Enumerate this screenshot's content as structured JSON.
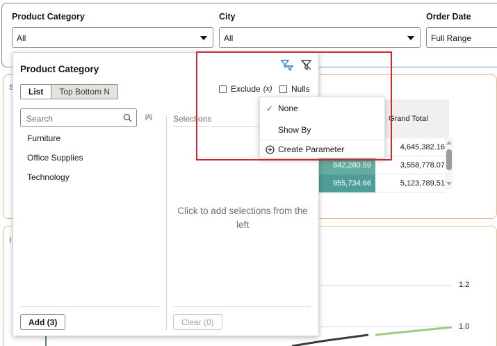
{
  "filters": [
    {
      "label": "Product Category",
      "value": "All"
    },
    {
      "label": "City",
      "value": "All"
    },
    {
      "label": "Order Date",
      "value": "Full Range"
    }
  ],
  "popup": {
    "title": "Product Category",
    "tabs": [
      {
        "label": "List"
      },
      {
        "label": "Top Bottom N"
      }
    ],
    "exclude_label": "Exclude",
    "exclude_suffix": "(x)",
    "nulls_label": "Nulls",
    "search_placeholder": "Search",
    "case_icon_text": "[A]",
    "items": [
      "Furniture",
      "Office Supplies",
      "Technology"
    ],
    "selections_label": "Selections",
    "empty_hint": "Click to add selections from the left",
    "add_button": "Add (3)",
    "clear_button": "Clear (0)"
  },
  "menu": {
    "items": [
      {
        "label": "None",
        "checked": true
      },
      {
        "label": "Show By",
        "checked": false
      },
      {
        "label": "Create Parameter",
        "checked": false
      }
    ]
  },
  "pivot": {
    "header": "Grand Total",
    "rows": [
      {
        "value": "",
        "total": "4,645,382.16"
      },
      {
        "value": "842,280.59",
        "total": "3,558,778.07"
      },
      {
        "value": "955,734.66",
        "total": "5,123,789.51"
      }
    ]
  },
  "chart": {
    "y_ticks": [
      "1.2",
      "1.0"
    ]
  },
  "colors": {
    "accent": "#2b6bb1",
    "teal": "#4f9d97",
    "highlight": "#d0262c",
    "panel_border": "#e6b98f"
  }
}
